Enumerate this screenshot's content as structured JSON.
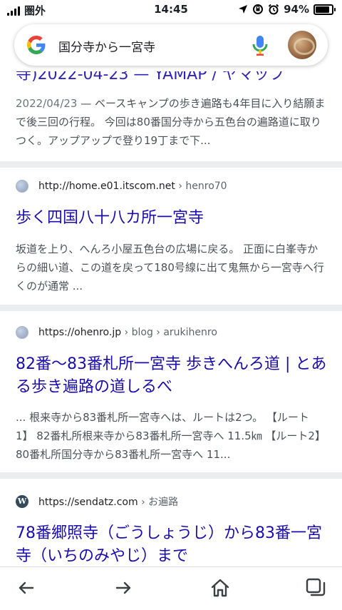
{
  "status_bar": {
    "carrier": "圏外",
    "time": "14:45",
    "battery_label": "94%",
    "battery_level": 0.94
  },
  "search": {
    "query": "国分寺から一宮寺"
  },
  "results": {
    "partial_title": "寺)2022-04-23 — YAMAP / ヤマップ",
    "first_snippet": {
      "date": "2022/04/23",
      "text": " — ベースキャンプの歩き遍路も4年目に入り結願まで後三回の行程。 今回は80番国分寺から五色台の遍路道に取りつく。アップアップで登り19丁まで下..."
    },
    "items": [
      {
        "url": "http://home.e01.itscom.net",
        "path": " › henro70",
        "title": "歩く四国八十八カ所一宮寺",
        "snippet": "坂道を上り、へんろ小屋五色台の広場に戻る。 正面に白峯寺からの細い道、この道を戻って180号線に出て鬼無から一宮寺へ行くのが通常 ..."
      },
      {
        "url": "https://ohenro.jp",
        "path": " › blog › arukihenro",
        "title": "82番〜83番札所一宮寺 歩きへんろ道 | とある歩き遍路の道しるべ",
        "snippet": "... 根来寺から83番札所一宮寺へは、ルートは2つ。 【ルート1】 82番札所根来寺から83番札所一宮寺へ 11.5㎞ 【ルート2】 80番札所国分寺から83番札所一宮寺へ 11..."
      },
      {
        "url": "https://sendatz.com",
        "path": " › お遍路",
        "title": "78番郷照寺（ごうしょうじ）から83番一宮寺（いちのみやじ）まで",
        "snippet": ""
      }
    ]
  },
  "toolbar": {
    "icons": [
      "back-arrow-icon",
      "forward-arrow-icon",
      "home-icon",
      "tabs-icon"
    ]
  }
}
